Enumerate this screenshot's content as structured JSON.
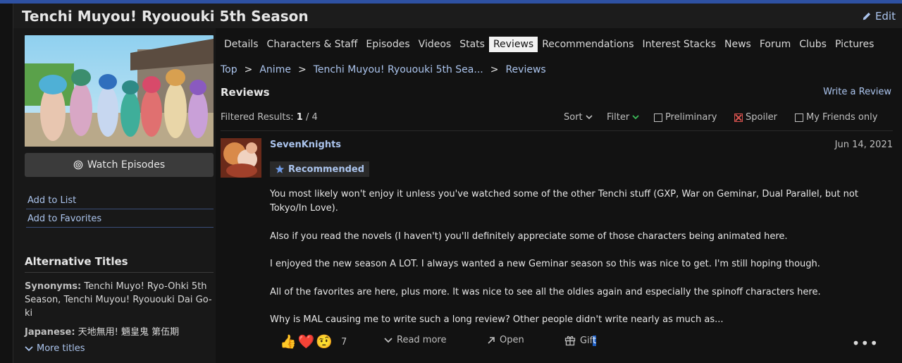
{
  "header": {
    "title": "Tenchi Muyou! Ryououki 5th Season",
    "edit_label": "Edit"
  },
  "sidebar": {
    "watch_label": "Watch Episodes",
    "links": [
      "Add to List",
      "Add to Favorites"
    ],
    "alt_heading": "Alternative Titles",
    "synonyms_label": "Synonyms:",
    "synonyms_value": "Tenchi Muyo! Ryo-Ohki 5th Season, Tenchi Muyou! Ryououki Dai Go-ki",
    "japanese_label": "Japanese:",
    "japanese_value": "天地無用! 魎皇鬼 第伍期",
    "more_titles": "More titles"
  },
  "tabs": [
    "Details",
    "Characters & Staff",
    "Episodes",
    "Videos",
    "Stats",
    "Reviews",
    "Recommendations",
    "Interest Stacks",
    "News",
    "Forum",
    "Clubs",
    "Pictures"
  ],
  "active_tab": "Reviews",
  "breadcrumbs": [
    "Top",
    "Anime",
    "Tenchi Muyou! Ryououki 5th Sea...",
    "Reviews"
  ],
  "reviews_section": {
    "title": "Reviews",
    "write_review": "Write a Review",
    "filtered_label": "Filtered Results:",
    "filtered_current": "1",
    "filtered_total": "/ 4",
    "sort_label": "Sort",
    "filter_label": "Filter",
    "checkboxes": [
      {
        "label": "Preliminary",
        "checked": false
      },
      {
        "label": "Spoiler",
        "checked": true
      },
      {
        "label": "My Friends only",
        "checked": false
      }
    ]
  },
  "review": {
    "username": "SevenKnights",
    "date": "Jun 14, 2021",
    "badge": "Recommended",
    "paragraphs": [
      "You most likely won't enjoy it unless you've watched some of the other Tenchi stuff (GXP, War on Geminar, Dual Parallel, but not Tokyo/In Love).",
      "Also if you read the novels (I haven't) you'll definitely appreciate some of those characters being animated here.",
      "I enjoyed the new season A LOT. I always wanted a new Geminar season so this was nice to get. I'm still hoping though.",
      "All of the favorites are here, plus more. It was nice to see all the oldies again and especially the spinoff characters here.",
      "Why is MAL causing me to write such a long review? Other people didn't write nearly as much as..."
    ],
    "reaction_count": "7",
    "read_more": "Read more",
    "open": "Open",
    "gift_prefix": "Gif",
    "gift_suffix": "t",
    "more": "•••"
  },
  "colors": {
    "accent": "#2e51a2",
    "link": "#abc4ed",
    "background": "#121212",
    "spoiler": "#d9534f"
  }
}
